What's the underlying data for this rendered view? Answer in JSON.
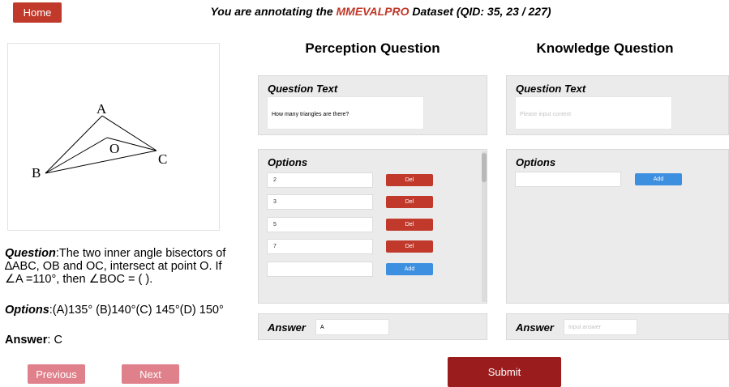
{
  "header": {
    "home_label": "Home",
    "title_prefix": "You are annotating the ",
    "dataset_name": "MMEVALPRO",
    "title_suffix": " Dataset (QID: 35, 23 / 227)"
  },
  "figure": {
    "label_a": "A",
    "label_b": "B",
    "label_c": "C",
    "label_o": "O"
  },
  "question": {
    "label": "Question",
    "text": ":The two inner angle bisectors of ∆ABC, OB and OC, intersect at point O. If ∠A =110°, then ∠BOC = ( )."
  },
  "options_line": {
    "label": "Options",
    "text": ":(A)135° (B)140°(C) 145°(D) 150°"
  },
  "answer_line": {
    "label": "Answer",
    "text": ": C"
  },
  "navigation": {
    "previous_label": "Previous",
    "next_label": "Next"
  },
  "perception": {
    "title": "Perception Question",
    "question_text_label": "Question Text",
    "question_text_value": "How many triangles are there?",
    "options_label": "Options",
    "options": [
      "2",
      "3",
      "5",
      "7"
    ],
    "del_label": "Del",
    "add_label": "Add",
    "answer_label": "Answer",
    "answer_value": "A"
  },
  "knowledge": {
    "title": "Knowledge Question",
    "question_text_label": "Question Text",
    "question_text_placeholder": "Please input context",
    "options_label": "Options",
    "add_label": "Add",
    "answer_label": "Answer",
    "answer_placeholder": "Input answer"
  },
  "submit_label": "Submit",
  "colors": {
    "accent_red": "#c0392b",
    "dark_red": "#9b1c1c",
    "pink": "#e0808b",
    "blue": "#3d8fe0",
    "panel_gray": "#ebebeb"
  }
}
